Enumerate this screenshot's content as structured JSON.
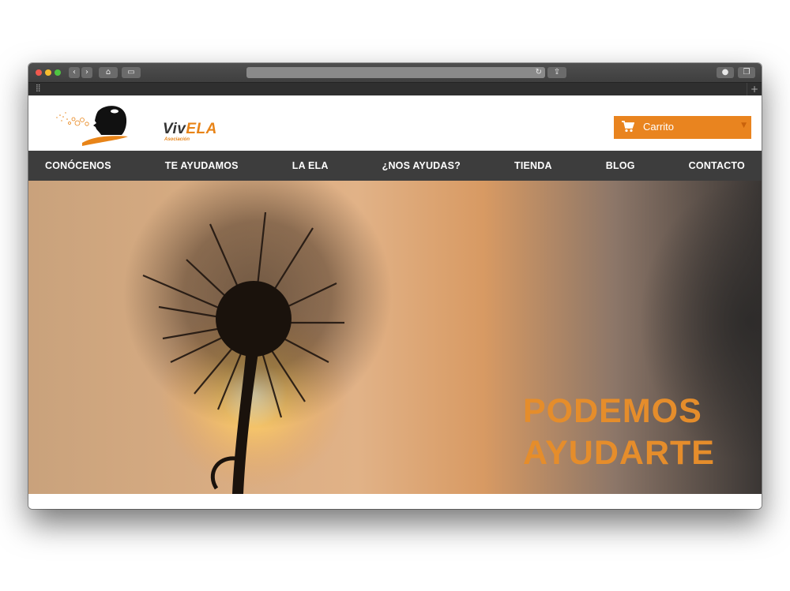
{
  "browser": {
    "back_icon": "chevron-left-icon",
    "forward_icon": "chevron-right-icon",
    "home_icon": "home-icon",
    "sidebar_icon": "sidebar-icon",
    "reload_icon": "reload-icon",
    "share_icon": "share-icon",
    "download_icon": "download-icon",
    "tabs_icon": "tabs-icon",
    "grid_icon": "grid-icon",
    "new_tab_icon": "plus-icon"
  },
  "site": {
    "logo_viv": "Viv",
    "logo_ela": "ELA",
    "logo_sub": "Asociación",
    "brand_color": "#e9841f"
  },
  "cart": {
    "label": "Carrito",
    "icon": "cart-icon",
    "caret_icon": "caret-down-icon"
  },
  "nav": {
    "items": [
      {
        "label": "CONÓCENOS"
      },
      {
        "label": "TE AYUDAMOS"
      },
      {
        "label": "LA ELA"
      },
      {
        "label": "¿NOS AYUDAS?"
      },
      {
        "label": "TIENDA"
      },
      {
        "label": "BLOG"
      },
      {
        "label": "CONTACTO"
      }
    ]
  },
  "hero": {
    "line1": "PODEMOS",
    "line2": "AYUDARTE",
    "text_color": "#e58d2b"
  }
}
